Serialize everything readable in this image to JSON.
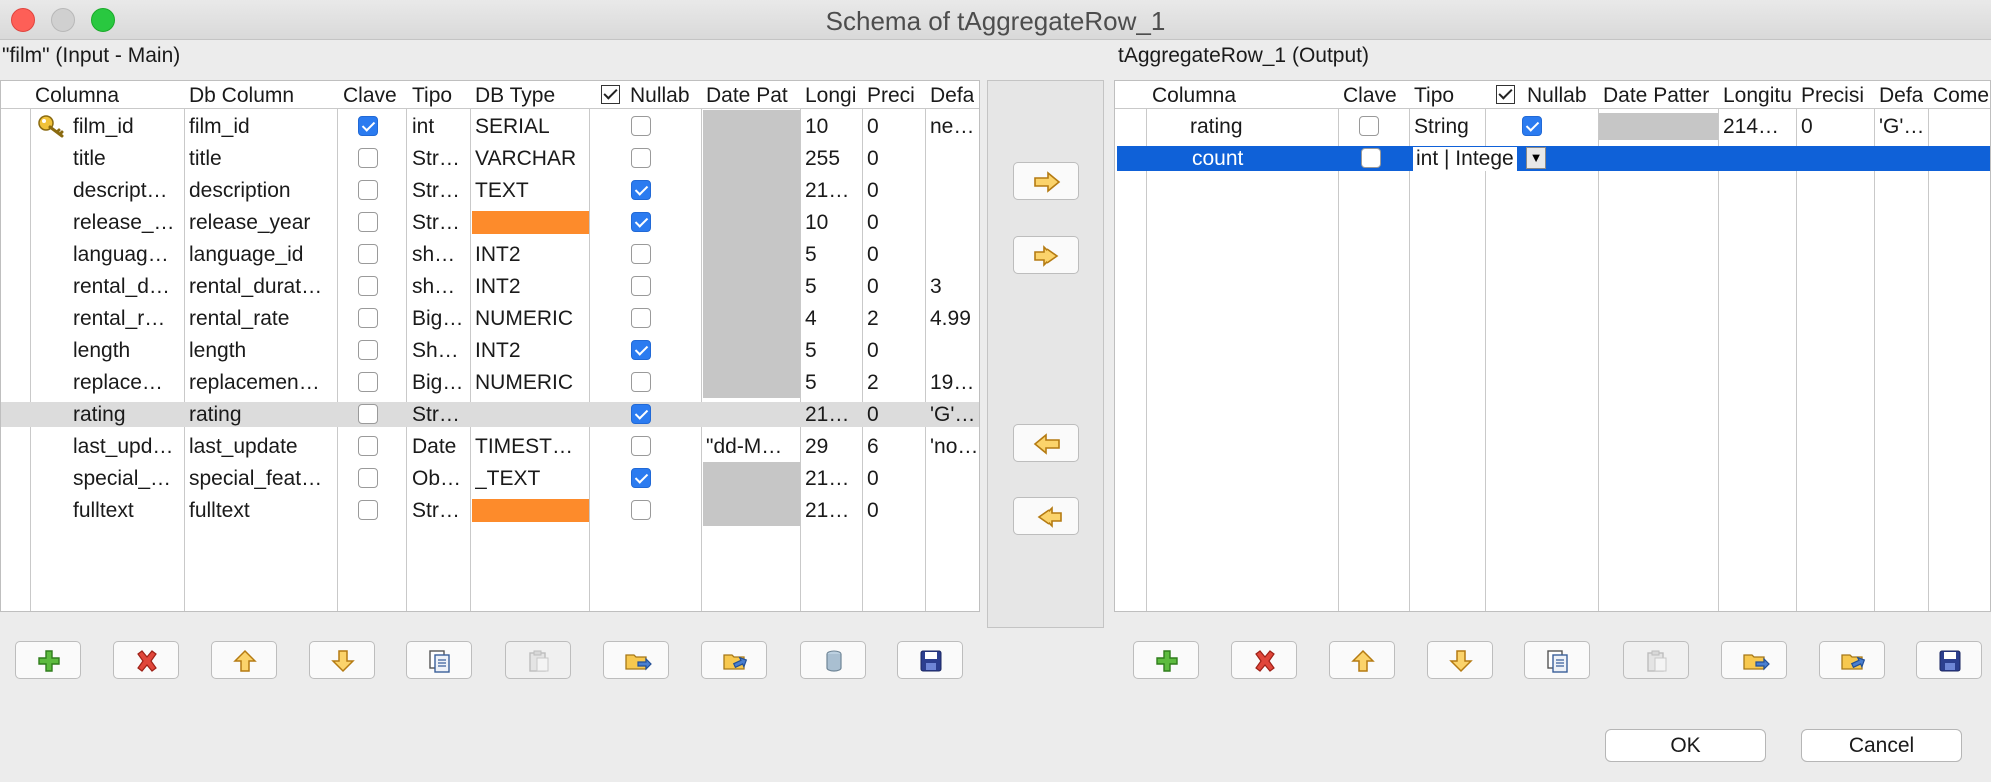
{
  "window": {
    "title": "Schema of tAggregateRow_1"
  },
  "left_panel": {
    "label": "\"film\" (Input - Main)",
    "headers": [
      "Columna",
      "Db Column",
      "Clave",
      "Tipo",
      "DB Type",
      "Nullab",
      "Date Pat",
      "Longi",
      "Preci",
      "Defa"
    ],
    "rows": [
      {
        "columna": "film_id",
        "db_column": "film_id",
        "clave": true,
        "tipo": "int",
        "db_type": "SERIAL",
        "nullable": false,
        "date_pattern": "",
        "longitud": "10",
        "precision": "0",
        "default": "ne…",
        "key": true
      },
      {
        "columna": "title",
        "db_column": "title",
        "clave": false,
        "tipo": "Str…",
        "db_type": "VARCHAR",
        "nullable": false,
        "date_pattern": "",
        "longitud": "255",
        "precision": "0",
        "default": ""
      },
      {
        "columna": "descript…",
        "db_column": "description",
        "clave": false,
        "tipo": "Str…",
        "db_type": "TEXT",
        "nullable": true,
        "date_pattern": "",
        "longitud": "21…",
        "precision": "0",
        "default": ""
      },
      {
        "columna": "release_…",
        "db_column": "release_year",
        "clave": false,
        "tipo": "Str…",
        "db_type": "",
        "db_type_orange": true,
        "nullable": true,
        "date_pattern": "",
        "longitud": "10",
        "precision": "0",
        "default": ""
      },
      {
        "columna": "languag…",
        "db_column": "language_id",
        "clave": false,
        "tipo": "sh…",
        "db_type": "INT2",
        "nullable": false,
        "date_pattern": "",
        "longitud": "5",
        "precision": "0",
        "default": ""
      },
      {
        "columna": "rental_d…",
        "db_column": "rental_durat…",
        "clave": false,
        "tipo": "sh…",
        "db_type": "INT2",
        "nullable": false,
        "date_pattern": "",
        "longitud": "5",
        "precision": "0",
        "default": "3"
      },
      {
        "columna": "rental_r…",
        "db_column": "rental_rate",
        "clave": false,
        "tipo": "Big…",
        "db_type": "NUMERIC",
        "nullable": false,
        "date_pattern": "",
        "longitud": "4",
        "precision": "2",
        "default": "4.99"
      },
      {
        "columna": "length",
        "db_column": "length",
        "clave": false,
        "tipo": "Sh…",
        "db_type": "INT2",
        "nullable": true,
        "date_pattern": "",
        "longitud": "5",
        "precision": "0",
        "default": ""
      },
      {
        "columna": "replace…",
        "db_column": "replacemen…",
        "clave": false,
        "tipo": "Big…",
        "db_type": "NUMERIC",
        "nullable": false,
        "date_pattern": "",
        "longitud": "5",
        "precision": "2",
        "default": "19…"
      },
      {
        "columna": "rating",
        "db_column": "rating",
        "clave": false,
        "tipo": "Str…",
        "db_type": "",
        "nullable": true,
        "date_pattern": "",
        "longitud": "21…",
        "precision": "0",
        "default": "'G'…",
        "selected": true,
        "no_gray": true
      },
      {
        "columna": "last_upd…",
        "db_column": "last_update",
        "clave": false,
        "tipo": "Date",
        "db_type": "TIMEST…",
        "nullable": false,
        "date_pattern": "\"dd-M…",
        "longitud": "29",
        "precision": "6",
        "default": "'no…",
        "no_gray": true
      },
      {
        "columna": "special_…",
        "db_column": "special_feat…",
        "clave": false,
        "tipo": "Ob…",
        "db_type": "_TEXT",
        "nullable": true,
        "date_pattern": "",
        "longitud": "21…",
        "precision": "0",
        "default": ""
      },
      {
        "columna": "fulltext",
        "db_column": "fulltext",
        "clave": false,
        "tipo": "Str…",
        "db_type": "",
        "db_type_orange": true,
        "nullable": false,
        "date_pattern": "",
        "longitud": "21…",
        "precision": "0",
        "default": ""
      }
    ]
  },
  "right_panel": {
    "label": "tAggregateRow_1 (Output)",
    "headers": [
      "Columna",
      "Clave",
      "Tipo",
      "Nullab",
      "Date Patter",
      "Longitu",
      "Precisi",
      "Defa",
      "Come"
    ],
    "rows": [
      {
        "columna": "rating",
        "clave": false,
        "tipo": "String",
        "nullable": true,
        "date_pattern": "",
        "longitud": "214…",
        "precision": "0",
        "default": "'G'…"
      },
      {
        "columna": "count",
        "clave": false,
        "tipo": "int | Intege",
        "nullable": false,
        "date_pattern": "",
        "longitud": "",
        "precision": "",
        "default": "",
        "selected": true
      }
    ]
  },
  "toolbar_icons": [
    "add-icon",
    "delete-icon",
    "move-up-icon",
    "move-down-icon",
    "copy-icon",
    "paste-icon",
    "import-icon",
    "export-icon",
    "repository-icon",
    "save-icon"
  ],
  "transfer_icons": [
    "copy-right-icon",
    "copy-all-right-icon",
    "copy-left-icon",
    "copy-all-left-icon"
  ],
  "dialog": {
    "ok_label": "OK",
    "cancel_label": "Cancel"
  },
  "colors": {
    "selection_blue": "#0f61d8",
    "orange_type": "#fd8b2b",
    "checkbox_blue": "#2b7bf0"
  }
}
